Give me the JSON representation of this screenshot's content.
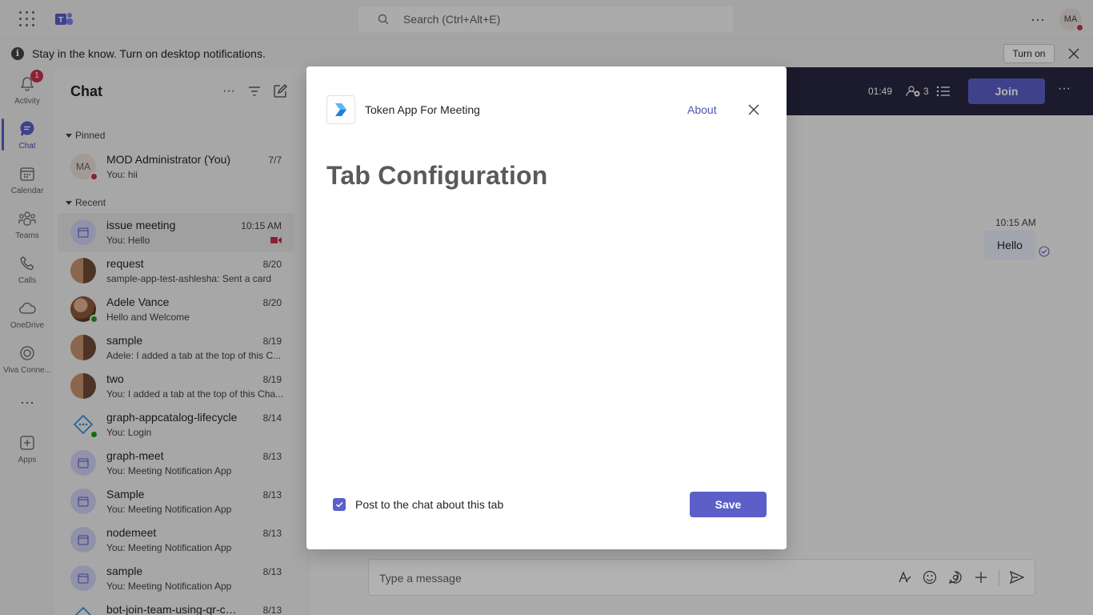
{
  "titlebar": {
    "search_placeholder": "Search (Ctrl+Alt+E)",
    "avatar_initials": "MA"
  },
  "banner": {
    "text": "Stay in the know. Turn on desktop notifications.",
    "turn_on_label": "Turn on"
  },
  "rail": {
    "items": [
      {
        "label": "Activity",
        "icon": "bell-icon",
        "badge": "1"
      },
      {
        "label": "Chat",
        "icon": "chat-icon"
      },
      {
        "label": "Calendar",
        "icon": "calendar-icon"
      },
      {
        "label": "Teams",
        "icon": "teams-icon"
      },
      {
        "label": "Calls",
        "icon": "phone-icon"
      },
      {
        "label": "OneDrive",
        "icon": "cloud-icon"
      },
      {
        "label": "Viva Conne...",
        "icon": "viva-icon"
      },
      {
        "label": "...",
        "icon": "more-icon"
      },
      {
        "label": "Apps",
        "icon": "apps-icon"
      }
    ]
  },
  "chatlist": {
    "title": "Chat",
    "pinned_label": "Pinned",
    "recent_label": "Recent",
    "pinned": [
      {
        "name": "MOD Administrator (You)",
        "preview": "You: hii",
        "time": "7/7",
        "initials": "MA"
      }
    ],
    "recent": [
      {
        "name": "issue meeting",
        "preview": "You: Hello",
        "time": "10:15 AM"
      },
      {
        "name": "request",
        "preview": "sample-app-test-ashlesha: Sent a card",
        "time": "8/20"
      },
      {
        "name": "Adele Vance",
        "preview": "Hello and Welcome",
        "time": "8/20"
      },
      {
        "name": "sample",
        "preview": "Adele: I added a tab at the top of this C...",
        "time": "8/19"
      },
      {
        "name": "two",
        "preview": "You: I added a tab at the top of this Cha...",
        "time": "8/19"
      },
      {
        "name": "graph-appcatalog-lifecycle",
        "preview": "You: Login",
        "time": "8/14"
      },
      {
        "name": "graph-meet",
        "preview": "You: Meeting Notification App",
        "time": "8/13"
      },
      {
        "name": "Sample",
        "preview": "You: Meeting Notification App",
        "time": "8/13"
      },
      {
        "name": "nodemeet",
        "preview": "You: Meeting Notification App",
        "time": "8/13"
      },
      {
        "name": "sample",
        "preview": "You: Meeting Notification App",
        "time": "8/13"
      },
      {
        "name": "bot-join-team-using-qr-code",
        "preview": "",
        "time": "8/13"
      }
    ]
  },
  "meeting": {
    "timer": "01:49",
    "participants": "3",
    "join_label": "Join",
    "message_time": "10:15 AM",
    "message_text": "Hello",
    "composer_placeholder": "Type a message"
  },
  "dialog": {
    "app_name": "Token App For Meeting",
    "about_label": "About",
    "title": "Tab Configuration",
    "checkbox_label": "Post to the chat about this tab",
    "checkbox_checked": true,
    "save_label": "Save"
  },
  "colors": {
    "brand": "#5b5fc7",
    "meeting_bar": "#292841",
    "presence_busy": "#c4314b",
    "presence_available": "#13a10e"
  }
}
